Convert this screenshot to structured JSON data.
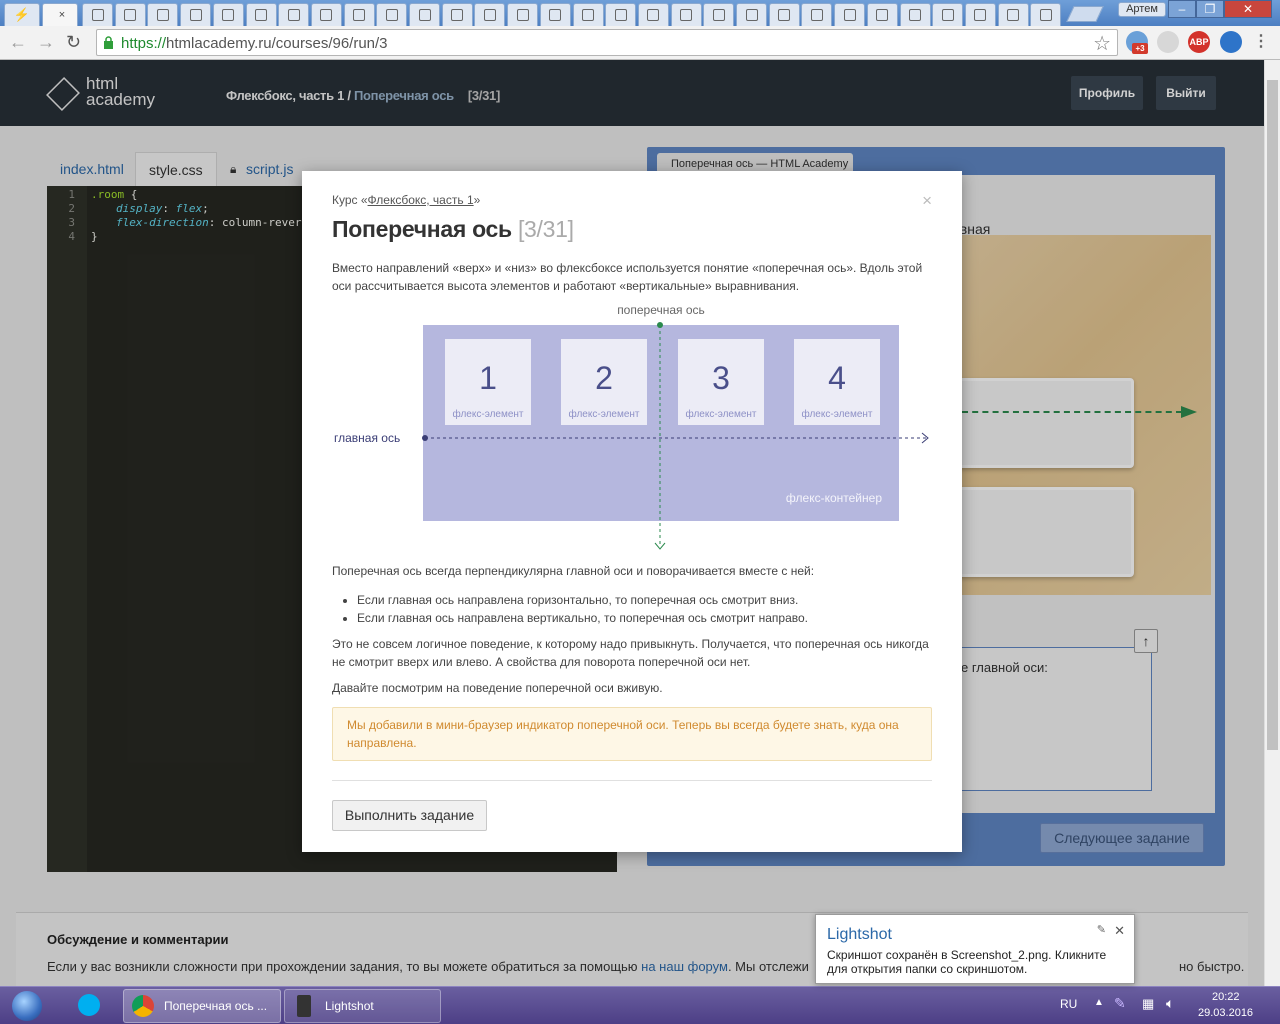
{
  "browser": {
    "tab_close": "×",
    "user_name": "Артем",
    "window_buttons": [
      "–",
      "❐",
      "✕"
    ],
    "url_scheme": "https://",
    "url_rest": "htmlacademy.ru/courses/96/run/3",
    "nav_back": "←",
    "nav_forward": "→",
    "nav_reload": "↻",
    "star": "☆",
    "ext_badge": "+3",
    "abp": "ABP"
  },
  "site": {
    "logo_line1": "html",
    "logo_line2": "academy",
    "crumb_course": "Флексбокс, часть 1",
    "crumb_sep": " / ",
    "crumb_current": "Поперечная ось",
    "crumb_progress": "[3/31]",
    "profile_button": "Профиль",
    "logout_button": "Выйти"
  },
  "editor": {
    "tabs": [
      "index.html",
      "style.css",
      "script.js"
    ],
    "active_tab": "style.css",
    "lines": [
      "1",
      "2",
      "3",
      "4"
    ],
    "code": {
      "l1_selector": ".room",
      "l1_brace": " {",
      "l2_prop": "display",
      "l2_val": "flex",
      "l3_prop": "flex-direction",
      "l3_val": "column-rever",
      "l4": "}"
    }
  },
  "preview": {
    "tab_title": "Поперечная ось — HTML Academy",
    "label_fragment": "авная",
    "task_fragment": "е главной оси:",
    "up_arrow": "↑",
    "next_button": "Следующее задание"
  },
  "modal": {
    "course_prefix": "Курс «",
    "course_link": "Флексбокс, часть 1",
    "course_suffix": "»",
    "close": "×",
    "title": "Поперечная ось",
    "counter": "[3/31]",
    "intro": "Вместо направлений «верх» и «низ» во флексбоксе используется понятие «поперечная ось». Вдоль этой оси рассчитывается высота элементов и работают «вертикальные» выравнивания.",
    "diagram": {
      "cross_axis_label": "поперечная ось",
      "main_axis_label": "главная ось",
      "container_label": "флекс-контейнер",
      "items": [
        {
          "number": "1",
          "caption": "флекс-элемент"
        },
        {
          "number": "2",
          "caption": "флекс-элемент"
        },
        {
          "number": "3",
          "caption": "флекс-элемент"
        },
        {
          "number": "4",
          "caption": "флекс-элемент"
        }
      ]
    },
    "p2": "Поперечная ось всегда перпендикулярна главной оси и поворачивается вместе с ней:",
    "bullets": [
      "Если главная ось направлена горизонтально, то поперечная ось смотрит вниз.",
      "Если главная ось направлена вертикально, то поперечная ось смотрит направо."
    ],
    "p3": "Это не совсем логичное поведение, к которому надо привыкнуть. Получается, что поперечная ось никогда не смотрит вверх или влево. А свойства для поворота поперечной оси нет.",
    "p4": "Давайте посмотрим на поведение поперечной оси вживую.",
    "note": "Мы добавили в мини-браузер индикатор поперечной оси. Теперь вы всегда будете знать, куда она направлена.",
    "run_button": "Выполнить задание"
  },
  "discussion": {
    "heading": "Обсуждение и комментарии",
    "text_before": "Если у вас возникли сложности при прохождении задания, то вы можете обратиться за помощью ",
    "link": "на наш форум",
    "text_after": ". Мы отслежи"
  },
  "discussion_tail": "но быстро.",
  "toast": {
    "title": "Lightshot",
    "message": "Скриншот сохранён в Screenshot_2.png. Кликните для открытия папки со скриншотом.",
    "close": "✕",
    "pin": "✎"
  },
  "taskbar": {
    "chrome_window": "Поперечная ось ...",
    "lightshot_window": "Lightshot",
    "lang": "RU",
    "time": "20:22",
    "date": "29.03.2016"
  },
  "colors": {
    "site_header": "#283038",
    "preview_frame": "#5e86c2",
    "diagram_container": "#b5b7de",
    "diagram_axis_main": "#3a3d75",
    "diagram_axis_cross": "#2b8a4d",
    "note_bg": "#fef7e6",
    "note_text": "#d08a2f"
  }
}
